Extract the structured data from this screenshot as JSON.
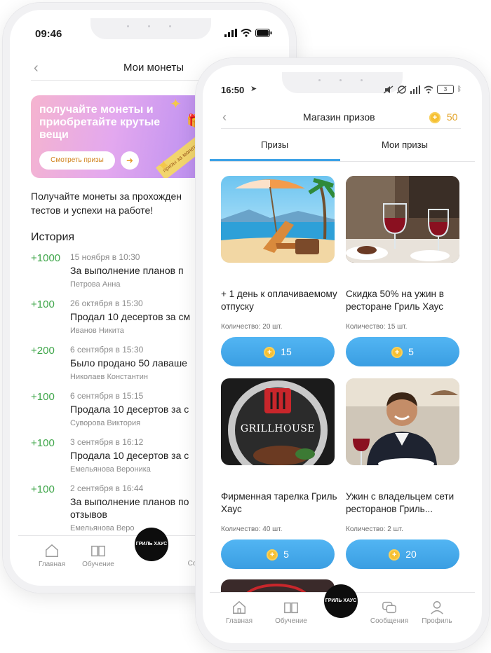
{
  "phone1": {
    "status_time": "09:46",
    "header": {
      "title": "Мои монеты"
    },
    "banner": {
      "text": "получайте монеты и приобретайте крутые вещи",
      "button_label": "Смотреть призы",
      "ribbon_text": "призы за монеты призы за монеты"
    },
    "description_line1": "Получайте монеты за прохожден",
    "description_line2": "тестов и успехи на работе!",
    "history_title": "История",
    "history": [
      {
        "amount": "+1000",
        "date": "15 ноября в 10:30",
        "title": "За выполнение планов п",
        "name": "Петрова Анна"
      },
      {
        "amount": "+100",
        "date": "26 октября в 15:30",
        "title": "Продал 10 десертов за см",
        "name": "Иванов Никита"
      },
      {
        "amount": "+200",
        "date": "6 сентября в 15:30",
        "title": "Было продано 50 лаваше",
        "name": "Николаев Константин"
      },
      {
        "amount": "+100",
        "date": "6 сентября в 15:15",
        "title": "Продала 10 десертов за с",
        "name": "Суворова Виктория"
      },
      {
        "amount": "+100",
        "date": "3 сентября в 16:12",
        "title": "Продала 10 десертов за с",
        "name": "Емельянова Вероника"
      },
      {
        "amount": "+100",
        "date": "2 сентября в 16:44",
        "title": "За выполнение планов по",
        "title2": "отзывов",
        "name": "Емельянова Веро"
      }
    ],
    "tabbar": {
      "home": "Главная",
      "learning": "Обучение",
      "messages": "Со"
    },
    "logo_text": "ГРИЛЬ ХАУС"
  },
  "phone2": {
    "status_time": "16:50",
    "battery": "3",
    "header": {
      "title": "Магазин призов",
      "balance": "50"
    },
    "tabs": {
      "prizes": "Призы",
      "my_prizes": "Мои призы"
    },
    "cards": [
      {
        "title": "+ 1 день к оплачиваемому отпуску",
        "qty": "Количество: 20 шт.",
        "price": "15"
      },
      {
        "title": "Скидка 50% на ужин в ресторане Гриль Хаус",
        "qty": "Количество: 15 шт.",
        "price": "5"
      },
      {
        "title": "Фирменная тарелка Гриль Хаус",
        "qty": "Количество: 40 шт.",
        "price": "5",
        "img_text": "GRILLHOUSE"
      },
      {
        "title": "Ужин с владельцем сети ресторанов Гриль...",
        "qty": "Количество: 2 шт.",
        "price": "20"
      }
    ],
    "tabbar": {
      "home": "Главная",
      "learning": "Обучение",
      "messages": "Сообщения",
      "profile": "Профиль"
    },
    "logo_text": "ГРИЛЬ ХАУС"
  },
  "colors": {
    "accent_blue": "#3da2e6",
    "coin": "#f6c033",
    "positive": "#3fa64a"
  }
}
